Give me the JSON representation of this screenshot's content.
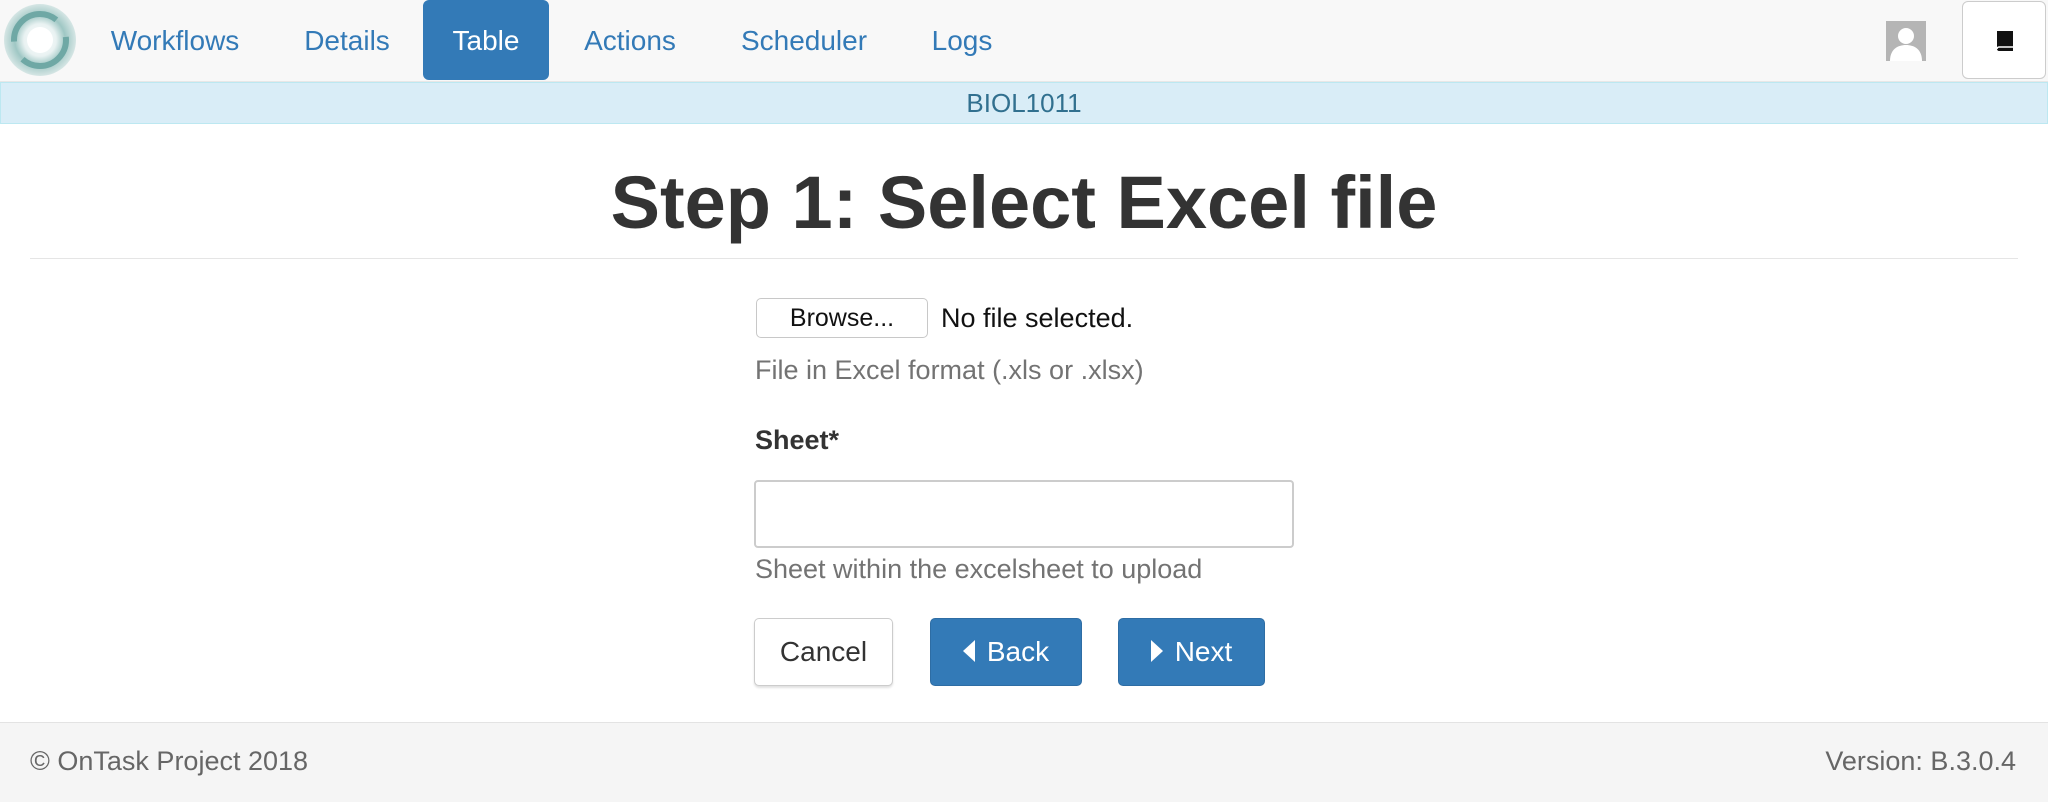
{
  "nav": {
    "items": [
      {
        "label": "Workflows",
        "active": false
      },
      {
        "label": "Details",
        "active": false
      },
      {
        "label": "Table",
        "active": true
      },
      {
        "label": "Actions",
        "active": false
      },
      {
        "label": "Scheduler",
        "active": false
      },
      {
        "label": "Logs",
        "active": false
      }
    ],
    "logo_icon": "ontask-logo-icon",
    "avatar_icon": "user-avatar-icon",
    "book_icon": "book-icon",
    "accent_color": "#337ab7"
  },
  "workflow_banner": {
    "name": "BIOL1011"
  },
  "page": {
    "title": "Step 1: Select Excel file"
  },
  "form": {
    "file": {
      "button_label": "Browse...",
      "status": "No file selected.",
      "help": "File in Excel format (.xls or .xlsx)"
    },
    "sheet": {
      "label": "Sheet*",
      "value": "",
      "help": "Sheet within the excelsheet to upload"
    },
    "buttons": {
      "cancel": "Cancel",
      "back": "Back",
      "next": "Next"
    }
  },
  "footer": {
    "copyright": "© OnTask Project 2018",
    "version": "Version: B.3.0.4"
  }
}
